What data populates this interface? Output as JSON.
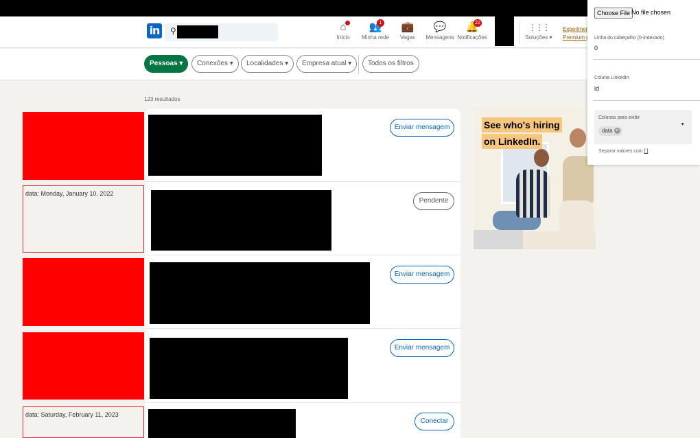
{
  "nav": {
    "logo": "in",
    "items": [
      {
        "label": "Início",
        "icon": "home-icon",
        "glyph": "⌂",
        "badge": ""
      },
      {
        "label": "Minha rede",
        "icon": "network-icon",
        "glyph": "👥",
        "badge": "1"
      },
      {
        "label": "Vagas",
        "icon": "briefcase-icon",
        "glyph": "💼",
        "badge": ""
      },
      {
        "label": "Mensagens",
        "icon": "messaging-icon",
        "glyph": "💬",
        "badge": ""
      },
      {
        "label": "Notificações",
        "icon": "bell-icon",
        "glyph": "🔔",
        "badge": "22"
      },
      {
        "label": "Soluções ▾",
        "icon": "grid-icon",
        "glyph": "⋮⋮⋮",
        "badge": ""
      }
    ],
    "premium_line1": "Experimente",
    "premium_line2": "Premium gr"
  },
  "filters": [
    {
      "label": "Pessoas ▾",
      "active": true
    },
    {
      "label": "Conexões ▾",
      "active": false
    },
    {
      "label": "Localidades ▾",
      "active": false
    },
    {
      "label": "Empresa atual ▾",
      "active": false
    },
    {
      "label": "Todos os filtros",
      "active": false
    }
  ],
  "results_count": "123 resultados",
  "results": [
    {
      "side": "red",
      "side_text": "",
      "action": "Enviar mensagem"
    },
    {
      "side": "box",
      "side_text": "data: Monday, January 10, 2022",
      "action": "Pendente"
    },
    {
      "side": "red",
      "side_text": "",
      "action": "Enviar mensagem"
    },
    {
      "side": "red",
      "side_text": "",
      "action": "Enviar mensagem"
    },
    {
      "side": "box",
      "side_text": "data: Saturday, February 11, 2023",
      "action": "Conectar"
    }
  ],
  "ad": {
    "line1": "See who's hiring",
    "line2": "on LinkedIn."
  },
  "extension": {
    "file_button": "Choose File",
    "file_status": "No file chosen",
    "header_row_label": "Linha do cabeçalho (0-indexado)",
    "header_row_value": "0",
    "linkedin_column_label": "Coluna LinkedIn",
    "linkedin_column_value": "id",
    "display_columns_label": "Colunas para exibir",
    "display_columns_tag": "data",
    "hint_prefix": "Separar valores com ",
    "hint_link": "[;]"
  },
  "colors": {
    "linkedin_blue": "#0a66c2",
    "active_filter_green": "#057642",
    "highlight_red": "#ff0000"
  }
}
